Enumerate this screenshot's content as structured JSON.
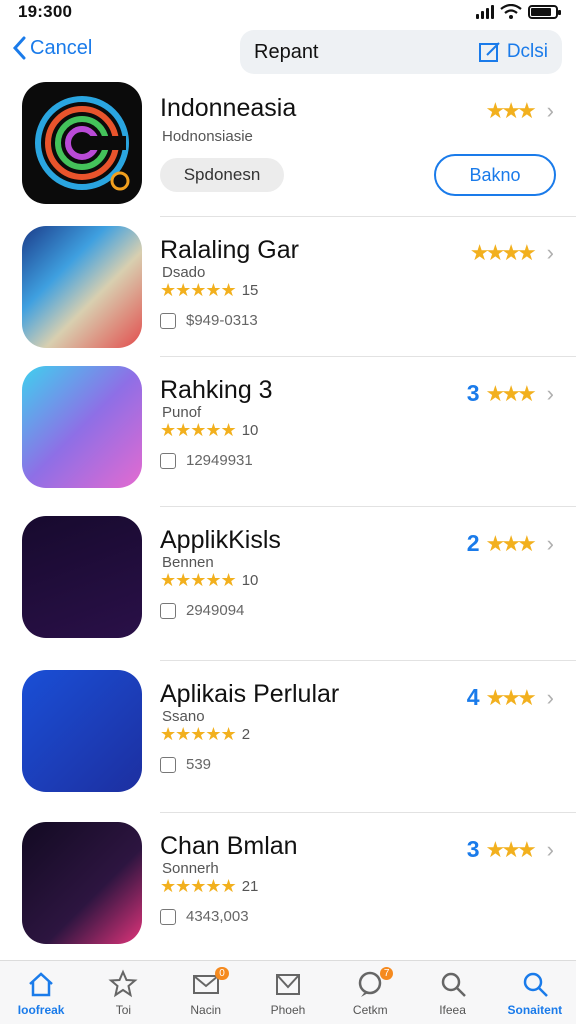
{
  "status": {
    "time": "19:300",
    "battery_level": 0.85
  },
  "nav": {
    "cancel_label": "Cancel",
    "search_text": "Repant",
    "edit_label": "Dclsi"
  },
  "featured": {
    "title": "Indonneasia",
    "subtitle": "Hodnonsiasie",
    "tag": "Spdonesn",
    "get_label": "Bakno",
    "rating_stars": "★★★"
  },
  "apps": [
    {
      "title": "Ralaling Gar",
      "subtitle": "Dsado",
      "stars": "★★★★★",
      "count": "15",
      "meta": "$949-0313",
      "rank": "",
      "rank_stars": "★★★★"
    },
    {
      "title": "Rahking 3",
      "subtitle": "Punof",
      "stars": "★★★★★",
      "count": "10",
      "meta": "12949931",
      "rank": "3",
      "rank_stars": "★★★"
    },
    {
      "title": "ApplikKisls",
      "subtitle": "Bennen",
      "stars": "★★★★★",
      "count": "10",
      "meta": "2949094",
      "rank": "2",
      "rank_stars": "★★★"
    },
    {
      "title": "Aplikais Perlular",
      "subtitle": "Ssano",
      "stars": "★★★★★",
      "count": "2",
      "meta": "539",
      "rank": "4",
      "rank_stars": "★★★"
    },
    {
      "title": "Chan Bmlan",
      "subtitle": "Sonnerh",
      "stars": "★★★★★",
      "count": "21",
      "meta": "4343,003",
      "rank": "3",
      "rank_stars": "★★★"
    }
  ],
  "tabs": [
    {
      "label": "Ioofreak",
      "icon": "home-icon",
      "active": true
    },
    {
      "label": "Toi",
      "icon": "star-icon"
    },
    {
      "label": "Nacin",
      "icon": "mail-icon",
      "badge": "0"
    },
    {
      "label": "Phoeh",
      "icon": "envelope-icon"
    },
    {
      "label": "Cetkm",
      "icon": "chat-icon",
      "badge": "7"
    },
    {
      "label": "Ifeea",
      "icon": "search-icon"
    },
    {
      "label": "Sonaitent",
      "icon": "search-icon",
      "active": true
    }
  ],
  "colors": {
    "accent": "#1a7bea",
    "star": "#f2b01e",
    "badge": "#f58a1f"
  }
}
